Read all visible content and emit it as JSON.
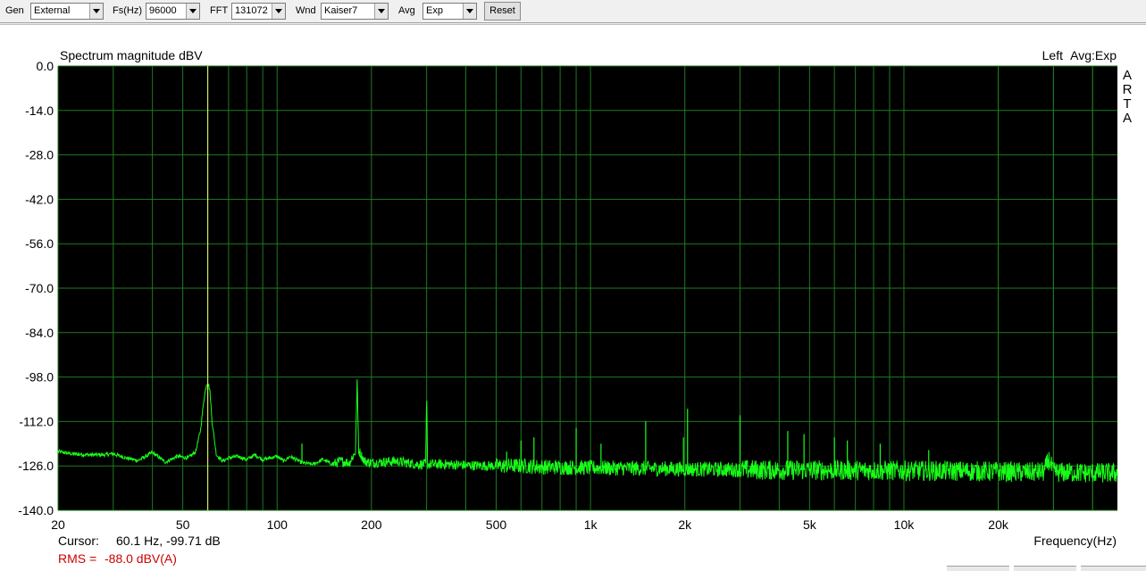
{
  "toolbar": {
    "gen_label": "Gen",
    "gen_value": "External",
    "fs_label": "Fs(Hz)",
    "fs_value": "96000",
    "fft_label": "FFT",
    "fft_value": "131072",
    "wnd_label": "Wnd",
    "wnd_value": "Kaiser7",
    "avg_label": "Avg",
    "avg_value": "Exp",
    "reset_label": "Reset"
  },
  "plot": {
    "channel": "Left",
    "avg_info": "Avg:Exp",
    "logo_letters": [
      "A",
      "R",
      "T",
      "A"
    ],
    "cursor_label": "Cursor:",
    "cursor_value": "60.1 Hz, -99.71 dB",
    "cursor_freq_hz": 60.1,
    "rms_label": "RMS =",
    "rms_value": "-88.0 dBV(A)"
  },
  "colors": {
    "plot_bg": "#000000",
    "grid": "#1f7a1f",
    "trace": "#19ff19",
    "cursor": "#ffff66",
    "rms_text": "#cc0000"
  },
  "chart_data": {
    "type": "line",
    "title": "Spectrum magnitude dBV",
    "xlabel": "Frequency(Hz)",
    "ylabel": "",
    "x_scale": "log",
    "xlim": [
      20,
      48000
    ],
    "ylim": [
      -140,
      0
    ],
    "grid": true,
    "yticks": [
      0,
      -14,
      -28,
      -42,
      -56,
      -70,
      -84,
      -98,
      -112,
      -126,
      -140
    ],
    "ytick_labels": [
      "0.0",
      "-14.0",
      "-28.0",
      "-42.0",
      "-56.0",
      "-70.0",
      "-84.0",
      "-98.0",
      "-112.0",
      "-126.0",
      "-140.0"
    ],
    "xticks": [
      20,
      50,
      100,
      200,
      500,
      1000,
      2000,
      5000,
      10000,
      20000
    ],
    "xtick_labels": [
      "20",
      "50",
      "100",
      "200",
      "500",
      "1k",
      "2k",
      "5k",
      "10k",
      "20k"
    ],
    "series": [
      {
        "x": [
          20,
          22,
          25,
          28,
          30,
          33,
          36,
          40,
          44,
          48,
          52,
          55,
          57,
          58.5,
          59.5,
          60.1,
          61,
          62,
          64,
          67,
          70,
          75,
          80,
          85,
          90,
          95,
          100,
          105,
          110,
          120,
          130,
          140,
          150,
          160,
          170,
          178,
          180,
          182,
          190,
          200,
          240,
          280,
          298,
          300,
          302,
          350,
          400,
          500,
          600,
          700,
          800,
          900,
          1000,
          1200,
          1500,
          2000,
          2500,
          3000,
          4000,
          5000,
          7000,
          10000,
          15000,
          20000,
          25000,
          28000,
          29000,
          30000,
          35000,
          40000,
          48000
        ],
        "y": [
          -121.5,
          -122.2,
          -122.5,
          -122.5,
          -122.2,
          -123.5,
          -124.3,
          -121.8,
          -124.8,
          -123.0,
          -123.5,
          -121.5,
          -114.5,
          -104.5,
          -100.5,
          -99.7,
          -102,
          -112,
          -122.5,
          -124.5,
          -123.5,
          -123,
          -124,
          -122.5,
          -124,
          -123.5,
          -123,
          -124.5,
          -123,
          -125,
          -125.5,
          -124,
          -125.5,
          -124.5,
          -125,
          -121.5,
          -99,
          -121,
          -124.5,
          -125,
          -124.5,
          -125.5,
          -125.5,
          -102.5,
          -125.5,
          -125.5,
          -125.8,
          -126,
          -126,
          -126.3,
          -126.4,
          -126.5,
          -126.6,
          -126.7,
          -126.8,
          -127,
          -127.1,
          -127.2,
          -127.3,
          -127.3,
          -127.4,
          -127.5,
          -127.6,
          -127.8,
          -128,
          -127.9,
          -124,
          -128,
          -128.1,
          -128.2,
          -128.3
        ]
      }
    ],
    "peaks": [
      {
        "x": 120,
        "y": -119
      },
      {
        "x": 180,
        "y": -99
      },
      {
        "x": 300,
        "y": -102.5
      },
      {
        "x": 540,
        "y": -121.5
      },
      {
        "x": 600,
        "y": -118
      },
      {
        "x": 660,
        "y": -117
      },
      {
        "x": 900,
        "y": -114
      },
      {
        "x": 1080,
        "y": -119
      },
      {
        "x": 1500,
        "y": -112
      },
      {
        "x": 1980,
        "y": -117
      },
      {
        "x": 2040,
        "y": -108
      },
      {
        "x": 3000,
        "y": -110
      },
      {
        "x": 4260,
        "y": -115
      },
      {
        "x": 4800,
        "y": -116
      },
      {
        "x": 6000,
        "y": -117
      },
      {
        "x": 6600,
        "y": -118
      },
      {
        "x": 8400,
        "y": -119
      },
      {
        "x": 12000,
        "y": -121
      }
    ]
  }
}
